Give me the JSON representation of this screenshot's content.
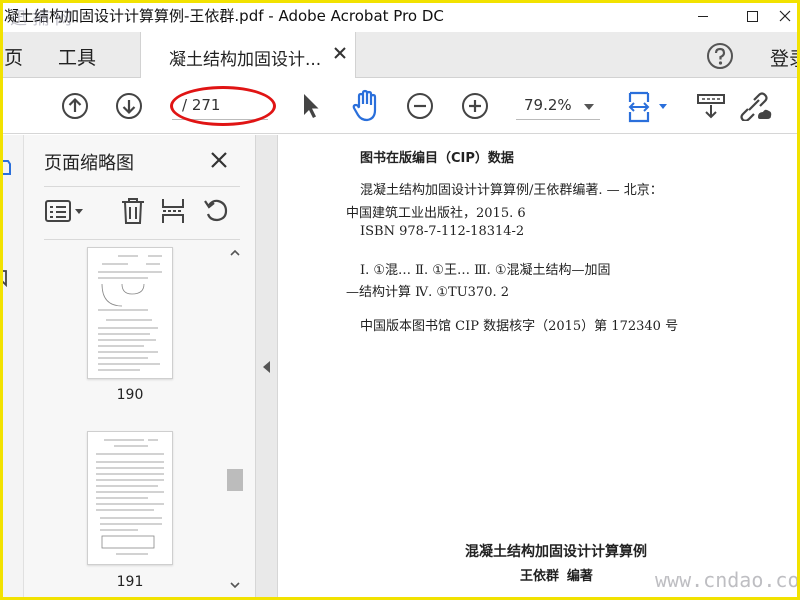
{
  "window": {
    "title": "凝土结构加固设计计算算例-王依群.pdf - Adobe Acrobat Pro DC",
    "watermark_top": "迅 捕 网"
  },
  "tabbar": {
    "home": "页",
    "tools": "工具",
    "doc_tab": "凝土结构加固设计...",
    "signin": "登录"
  },
  "toolbar": {
    "page_count": "/ 271",
    "zoom": "79.2%"
  },
  "thumbnail_panel": {
    "title": "页面缩略图",
    "thumbs": [
      {
        "page": "190"
      },
      {
        "page": "191"
      }
    ]
  },
  "document": {
    "cip_title": "图书在版编目（CIP）数据",
    "line1": "混凝土结构加固设计计算算例/王依群编著. — 北京：",
    "line2": "中国建筑工业出版社，2015. 6",
    "line3": "ISBN 978-7-112-18314-2",
    "line4": "Ⅰ. ①混…   Ⅱ. ①王…   Ⅲ. ①混凝土结构—加固",
    "line5": "—结构计算   Ⅳ. ①TU370. 2",
    "line6": "中国版本图书馆 CIP 数据核字（2015）第 172340 号",
    "book_title": "混凝土结构加固设计计算算例",
    "author": "王依群  编著"
  },
  "watermark_bottom": "www.cndao.com",
  "colors": {
    "accent": "#2a6fdb",
    "highlight": "#e01414",
    "frame": "#f2e200"
  }
}
